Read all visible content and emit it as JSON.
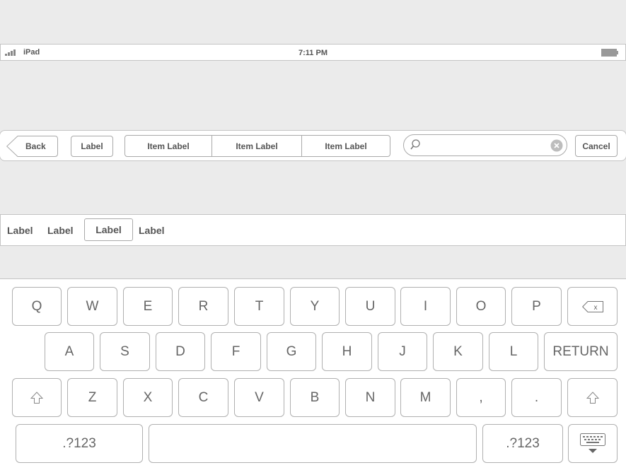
{
  "status_bar": {
    "carrier": "iPad",
    "time": "7:11 PM"
  },
  "toolbar": {
    "back_label": "Back",
    "label_button": "Label",
    "segments": [
      "Item Label",
      "Item Label",
      "Item Label"
    ],
    "search": {
      "value": "",
      "placeholder": ""
    },
    "cancel_label": "Cancel"
  },
  "scope_bar": {
    "items": [
      "Label",
      "Label",
      "Label",
      "Label"
    ],
    "selected_index": 2
  },
  "keyboard": {
    "row1": [
      "Q",
      "W",
      "E",
      "R",
      "T",
      "Y",
      "U",
      "I",
      "O",
      "P"
    ],
    "row2": [
      "A",
      "S",
      "D",
      "F",
      "G",
      "H",
      "J",
      "K",
      "L"
    ],
    "return_label": "RETURN",
    "row3": [
      "Z",
      "X",
      "C",
      "V",
      "B",
      "N",
      "M",
      ",",
      "."
    ],
    "numbers_label_left": ".?123",
    "numbers_label_right": ".?123",
    "backspace_glyph": "x"
  }
}
